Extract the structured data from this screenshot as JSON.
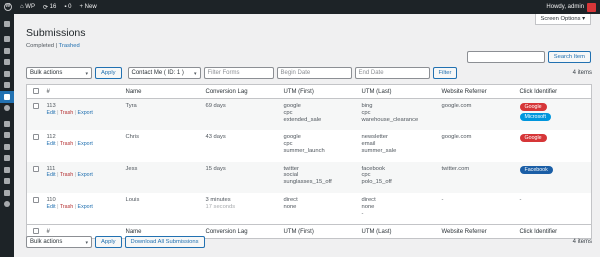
{
  "adminbar": {
    "site_name": "WP",
    "updates_count": "16",
    "comments_count": "0",
    "new_label": "New",
    "howdy": "Howdy, admin"
  },
  "screen_options_label": "Screen Options ▾",
  "page": {
    "title": "Submissions",
    "filter_completed": "Completed",
    "filter_sep": " | ",
    "filter_trashed": "Trashed"
  },
  "search": {
    "button": "Search Item",
    "placeholder": ""
  },
  "top_nav": {
    "bulk_actions": "Bulk actions",
    "apply": "Apply",
    "form_select": "Contact Me ( ID: 1 )",
    "filter_forms_placeholder": "Filter Forms",
    "begin_date_placeholder": "Begin Date",
    "end_date_placeholder": "End Date",
    "filter_button": "Filter",
    "count": "4 items"
  },
  "bottom_nav": {
    "bulk_actions": "Bulk actions",
    "apply": "Apply",
    "download": "Download All Submissions",
    "count": "4 items"
  },
  "columns": [
    "#",
    "Name",
    "Conversion Lag",
    "UTM (First)",
    "UTM (Last)",
    "Website Referrer",
    "Click Identifier"
  ],
  "row_action_labels": {
    "edit": "Edit",
    "sep": " | ",
    "trash": "Trash",
    "export": "Export"
  },
  "rows": [
    {
      "id": "113",
      "name": "Tyra",
      "lag": "69 days",
      "lag_sub": "",
      "utm_first": [
        "google",
        "cpc",
        "extended_sale"
      ],
      "utm_last": [
        "bing",
        "cpc",
        "warehouse_clearance"
      ],
      "referrer": "google.com",
      "tags": [
        "Google",
        "Microsoft"
      ]
    },
    {
      "id": "112",
      "name": "Chris",
      "lag": "43 days",
      "lag_sub": "",
      "utm_first": [
        "google",
        "cpc",
        "summer_launch"
      ],
      "utm_last": [
        "newsletter",
        "email",
        "summer_sale"
      ],
      "referrer": "google.com",
      "tags": [
        "Google"
      ]
    },
    {
      "id": "111",
      "name": "Jess",
      "lag": "15 days",
      "lag_sub": "",
      "utm_first": [
        "twitter",
        "social",
        "sunglasses_15_off"
      ],
      "utm_last": [
        "facebook",
        "cpc",
        "polo_15_off"
      ],
      "referrer": "twitter.com",
      "tags": [
        "Facebook"
      ]
    },
    {
      "id": "110",
      "name": "Louis",
      "lag": "3 minutes",
      "lag_sub": "17 seconds",
      "utm_first": [
        "direct",
        "none",
        ""
      ],
      "utm_last": [
        "direct",
        "none",
        "-"
      ],
      "referrer": "-",
      "tags": [
        "-"
      ]
    }
  ],
  "colors": {
    "google": "#d63638",
    "microsoft": "#0096dd",
    "facebook": "#1a5ea6",
    "accent": "#2271b1"
  }
}
